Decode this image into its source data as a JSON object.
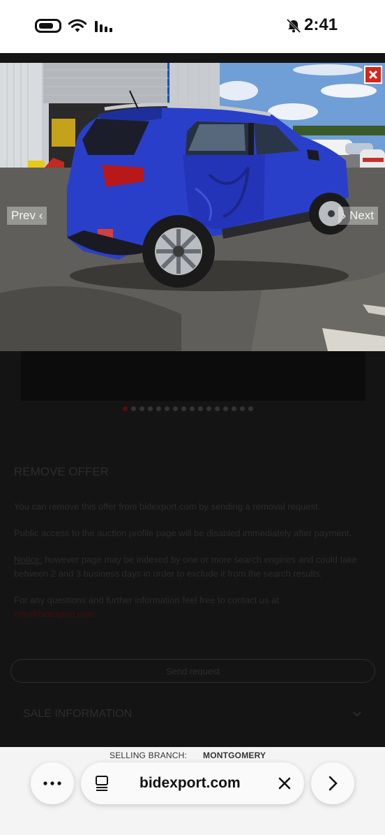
{
  "status_bar": {
    "time": "2:41"
  },
  "viewer": {
    "prev_label": "Prev",
    "next_label": "Next",
    "thumbnail_count": 16,
    "active_thumbnail": 1
  },
  "remove_offer": {
    "heading": "REMOVE OFFER",
    "p1": "You can remove this offer from bidexport.com by sending a removal request.",
    "p2": "Public access to the auction profile page will be disabled immediately after payment.",
    "notice_label": "Notice:",
    "p3": " however page may be indexed by one or more search engines and could take between 2 and 3 business days in order to exclude it from the search results.",
    "p4": "For any questions and further information feel free to contact us at",
    "email": "info@bidexport.com",
    "send_button": "Send request"
  },
  "sale_info": {
    "heading": "SALE INFORMATION"
  },
  "branch": {
    "label": "SELLING BRANCH:",
    "value": "MONTGOMERY"
  },
  "browser": {
    "url": "bidexport.com"
  },
  "colors": {
    "car_blue": "#2a3fc9",
    "close_red": "#d8251c"
  }
}
